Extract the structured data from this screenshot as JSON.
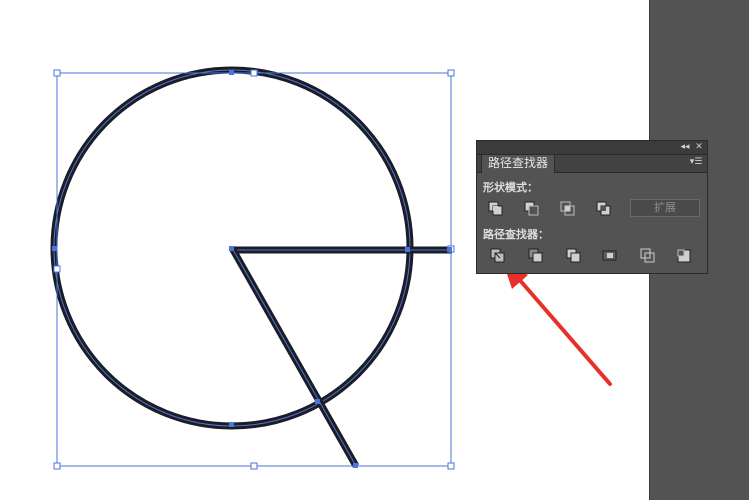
{
  "panel": {
    "tab_title": "路径查找器",
    "shape_modes_label": "形状模式：",
    "pathfinders_label": "路径查找器：",
    "expand_label": "扩展",
    "collapse_icon": "double-chevron-left-icon",
    "close_icon": "close-icon",
    "menu_icon": "panel-menu-icon",
    "shape_modes": [
      "unite-icon",
      "minus-front-icon",
      "intersect-icon",
      "exclude-icon"
    ],
    "pathfinders": [
      "divide-icon",
      "trim-icon",
      "merge-icon",
      "crop-icon",
      "outline-icon",
      "minus-back-icon"
    ]
  },
  "colors": {
    "stroke_dark": "#1c1c24",
    "selection_blue": "#4a76d8",
    "arrow_red": "#e8302a",
    "panel_bg": "#535353"
  }
}
